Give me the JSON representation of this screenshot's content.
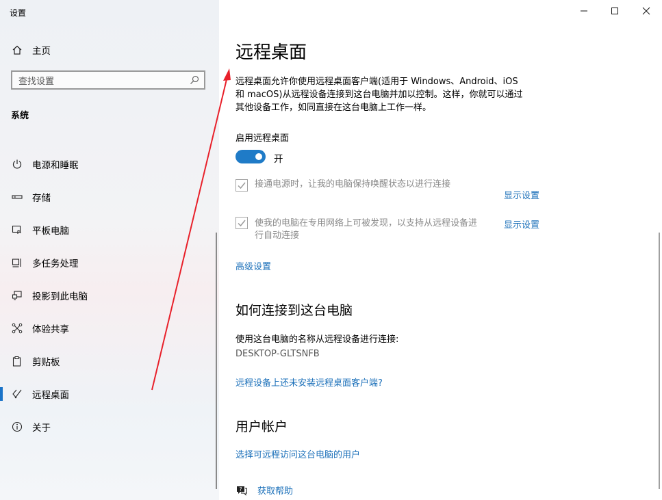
{
  "window": {
    "title": "设置",
    "minimize_icon": "minimize-icon",
    "maximize_icon": "maximize-icon",
    "close_icon": "close-icon"
  },
  "sidebar": {
    "home": {
      "label": "主页",
      "icon": "home-icon"
    },
    "search": {
      "placeholder": "查找设置",
      "icon": "search-icon"
    },
    "section_title": "系统",
    "items": [
      {
        "label": "电源和睡眠",
        "icon": "power-icon"
      },
      {
        "label": "存储",
        "icon": "storage-icon"
      },
      {
        "label": "平板电脑",
        "icon": "tablet-icon"
      },
      {
        "label": "多任务处理",
        "icon": "multitasking-icon"
      },
      {
        "label": "投影到此电脑",
        "icon": "projecting-icon"
      },
      {
        "label": "体验共享",
        "icon": "shared-experiences-icon"
      },
      {
        "label": "剪贴板",
        "icon": "clipboard-icon"
      },
      {
        "label": "远程桌面",
        "icon": "remote-desktop-icon",
        "selected": true
      },
      {
        "label": "关于",
        "icon": "info-icon"
      }
    ]
  },
  "main": {
    "title": "远程桌面",
    "description_lines": [
      "远程桌面允许你使用远程桌面客户端(适用于 Windows、Android、iOS",
      "和 macOS)从远程设备连接到这台电脑并加以控制。这样，你就可以通过",
      "其他设备工作，如同直接在这台电脑上工作一样。"
    ],
    "enable_label": "启用远程桌面",
    "enable_state": "开",
    "enable_on": true,
    "option1": {
      "text": "接通电源时，让我的电脑保持唤醒状态以进行连接",
      "link": "显示设置",
      "checked": true
    },
    "option2": {
      "text_lines": [
        "使我的电脑在专用网络上可被发现，以支持从远程设备进",
        "行自动连接"
      ],
      "link": "显示设置",
      "checked": true
    },
    "advanced_link": "高级设置",
    "how_heading": "如何连接到这台电脑",
    "how_text": "使用这台电脑的名称从远程设备进行连接:",
    "pc_name": "DESKTOP-GLTSNFB",
    "client_link": "远程设备上还未安装远程桌面客户端?",
    "accounts_heading": "用户帐户",
    "accounts_link": "选择可远程访问这台电脑的用户",
    "help": {
      "label": "获取帮助",
      "icon": "help-chat-icon"
    }
  },
  "colors": {
    "accent": "#1a73c8",
    "link": "#1a6fb9",
    "annotation_arrow": "#e8202a"
  }
}
